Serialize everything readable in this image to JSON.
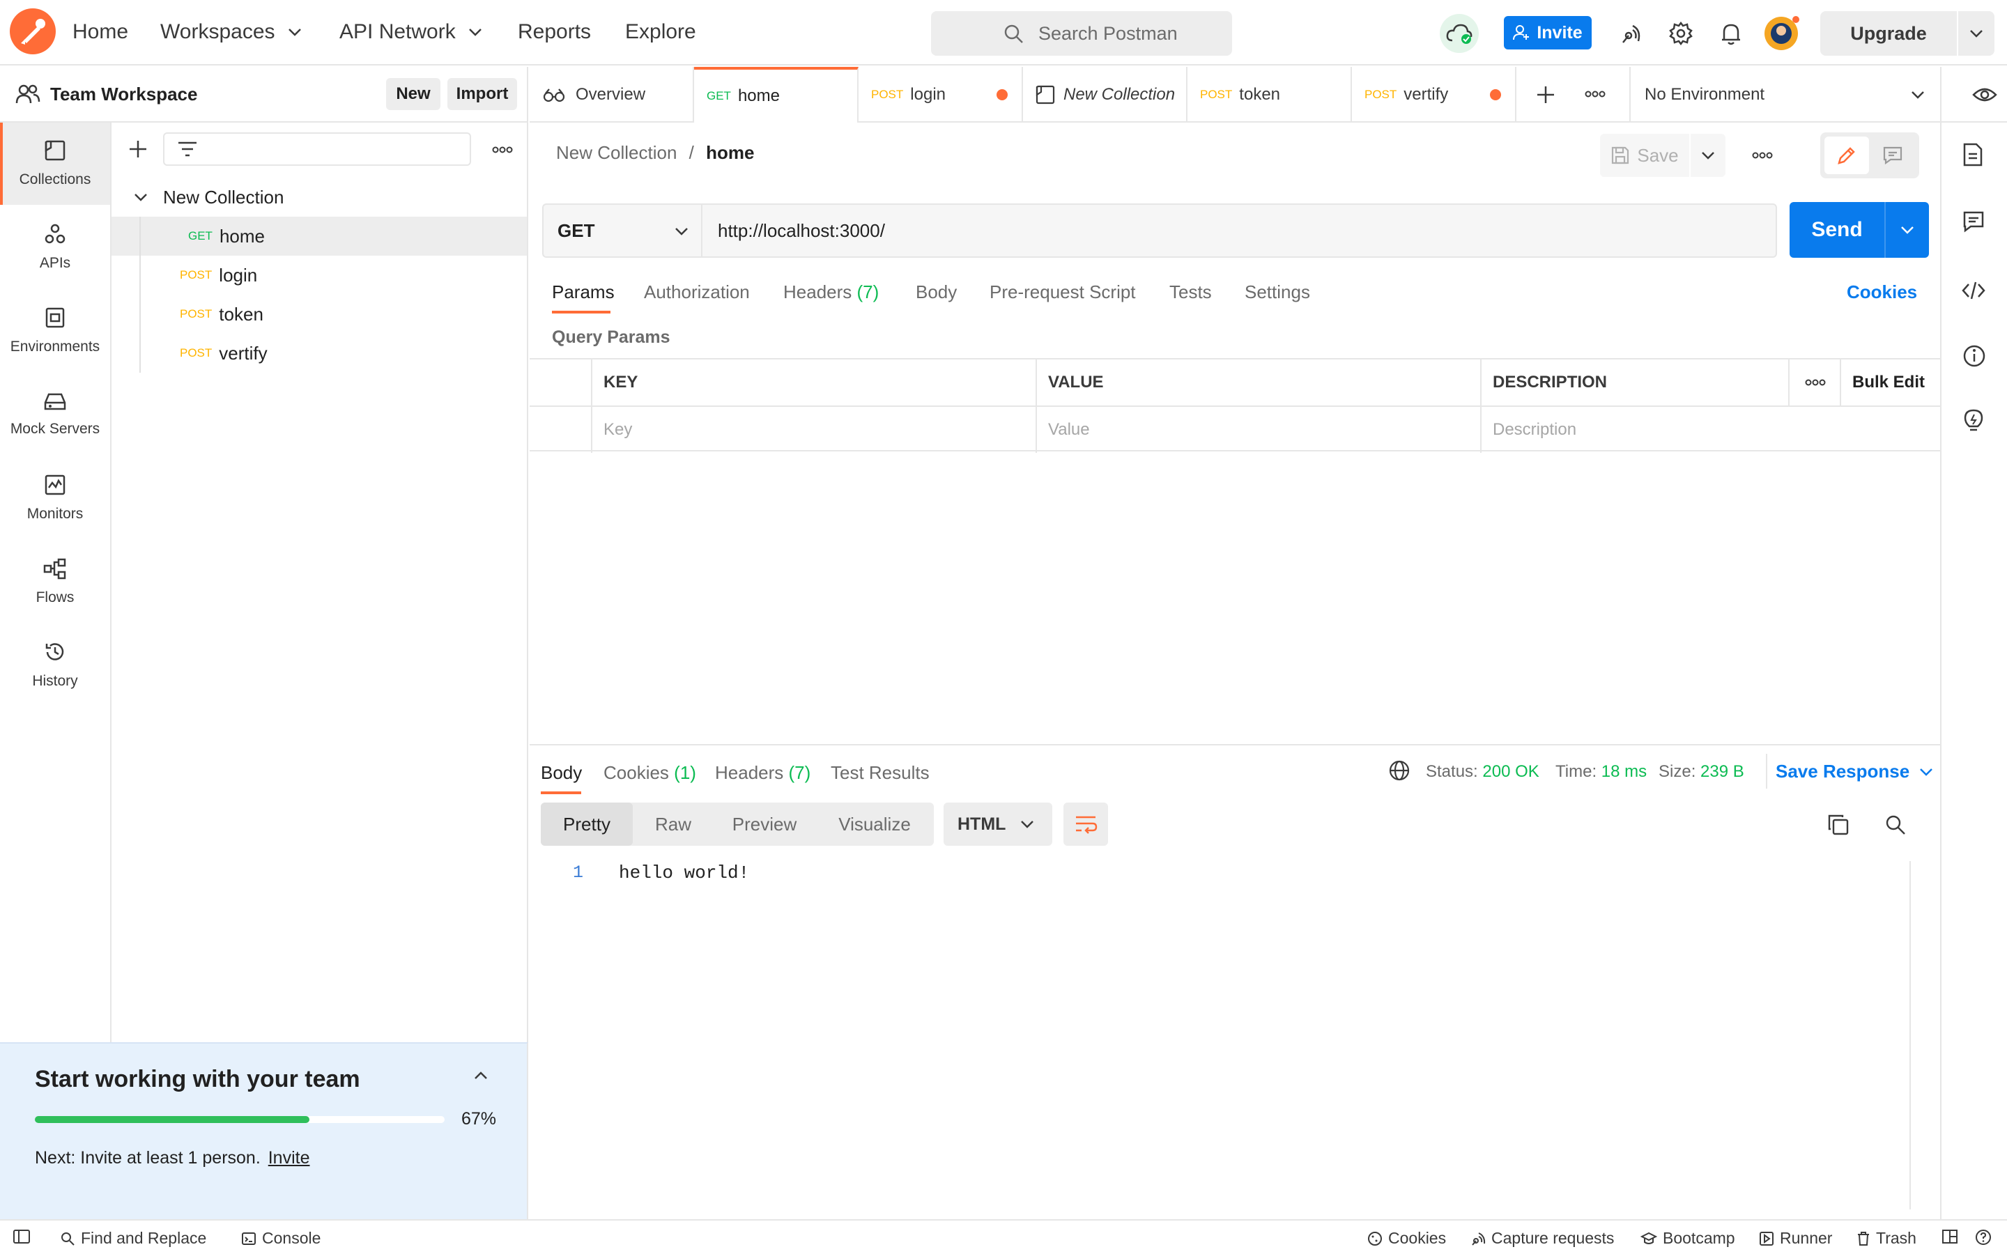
{
  "topbar": {
    "nav": [
      "Home",
      "Workspaces",
      "API Network",
      "Reports",
      "Explore"
    ],
    "search_placeholder": "Search Postman",
    "invite_label": "Invite",
    "upgrade_label": "Upgrade"
  },
  "workspace": {
    "name": "Team Workspace",
    "new_label": "New",
    "import_label": "Import"
  },
  "rail": [
    "Collections",
    "APIs",
    "Environments",
    "Mock Servers",
    "Monitors",
    "Flows",
    "History"
  ],
  "tree": {
    "collection": "New Collection",
    "requests": [
      {
        "method": "GET",
        "name": "home"
      },
      {
        "method": "POST",
        "name": "login"
      },
      {
        "method": "POST",
        "name": "token"
      },
      {
        "method": "POST",
        "name": "vertify"
      }
    ]
  },
  "onboarding": {
    "title": "Start working with your team",
    "progress": 0.67,
    "progress_label": "67%",
    "next_text": "Next: Invite at least 1 person.",
    "next_link": "Invite"
  },
  "tabs": [
    {
      "method": "",
      "name": "Overview"
    },
    {
      "method": "GET",
      "name": "home"
    },
    {
      "method": "POST",
      "name": "login"
    },
    {
      "method": "",
      "name": "New Collection"
    },
    {
      "method": "POST",
      "name": "token"
    },
    {
      "method": "POST",
      "name": "vertify"
    }
  ],
  "environment": "No Environment",
  "request": {
    "breadcrumb_parent": "New Collection",
    "breadcrumb_sep": "/",
    "breadcrumb_current": "home",
    "save_label": "Save",
    "method": "GET",
    "url": "http://localhost:3000/",
    "send_label": "Send",
    "tabs": [
      "Params",
      "Authorization",
      "Headers",
      "Body",
      "Pre-request Script",
      "Tests",
      "Settings"
    ],
    "headers_count": "(7)",
    "cookies_label": "Cookies",
    "query_params_label": "Query Params",
    "columns": [
      "KEY",
      "VALUE",
      "DESCRIPTION"
    ],
    "bulk_edit": "Bulk Edit",
    "placeholders": [
      "Key",
      "Value",
      "Description"
    ]
  },
  "response": {
    "tabs": [
      "Body",
      "Cookies",
      "Headers",
      "Test Results"
    ],
    "cookies_count": "(1)",
    "headers_count": "(7)",
    "status_label": "Status:",
    "status_value": "200 OK",
    "time_label": "Time:",
    "time_value": "18 ms",
    "size_label": "Size:",
    "size_value": "239 B",
    "save_response": "Save Response",
    "formats": [
      "Pretty",
      "Raw",
      "Preview",
      "Visualize"
    ],
    "language": "HTML",
    "line_number": "1",
    "body_line": "hello world!"
  },
  "statusbar": {
    "left": [
      "Find and Replace",
      "Console"
    ],
    "right": [
      "Cookies",
      "Capture requests",
      "Bootcamp",
      "Runner",
      "Trash"
    ]
  },
  "colors": {
    "accent": "#ff6c37",
    "primary": "#097bed",
    "get": "#0cbb52",
    "post": "#ffb400"
  }
}
